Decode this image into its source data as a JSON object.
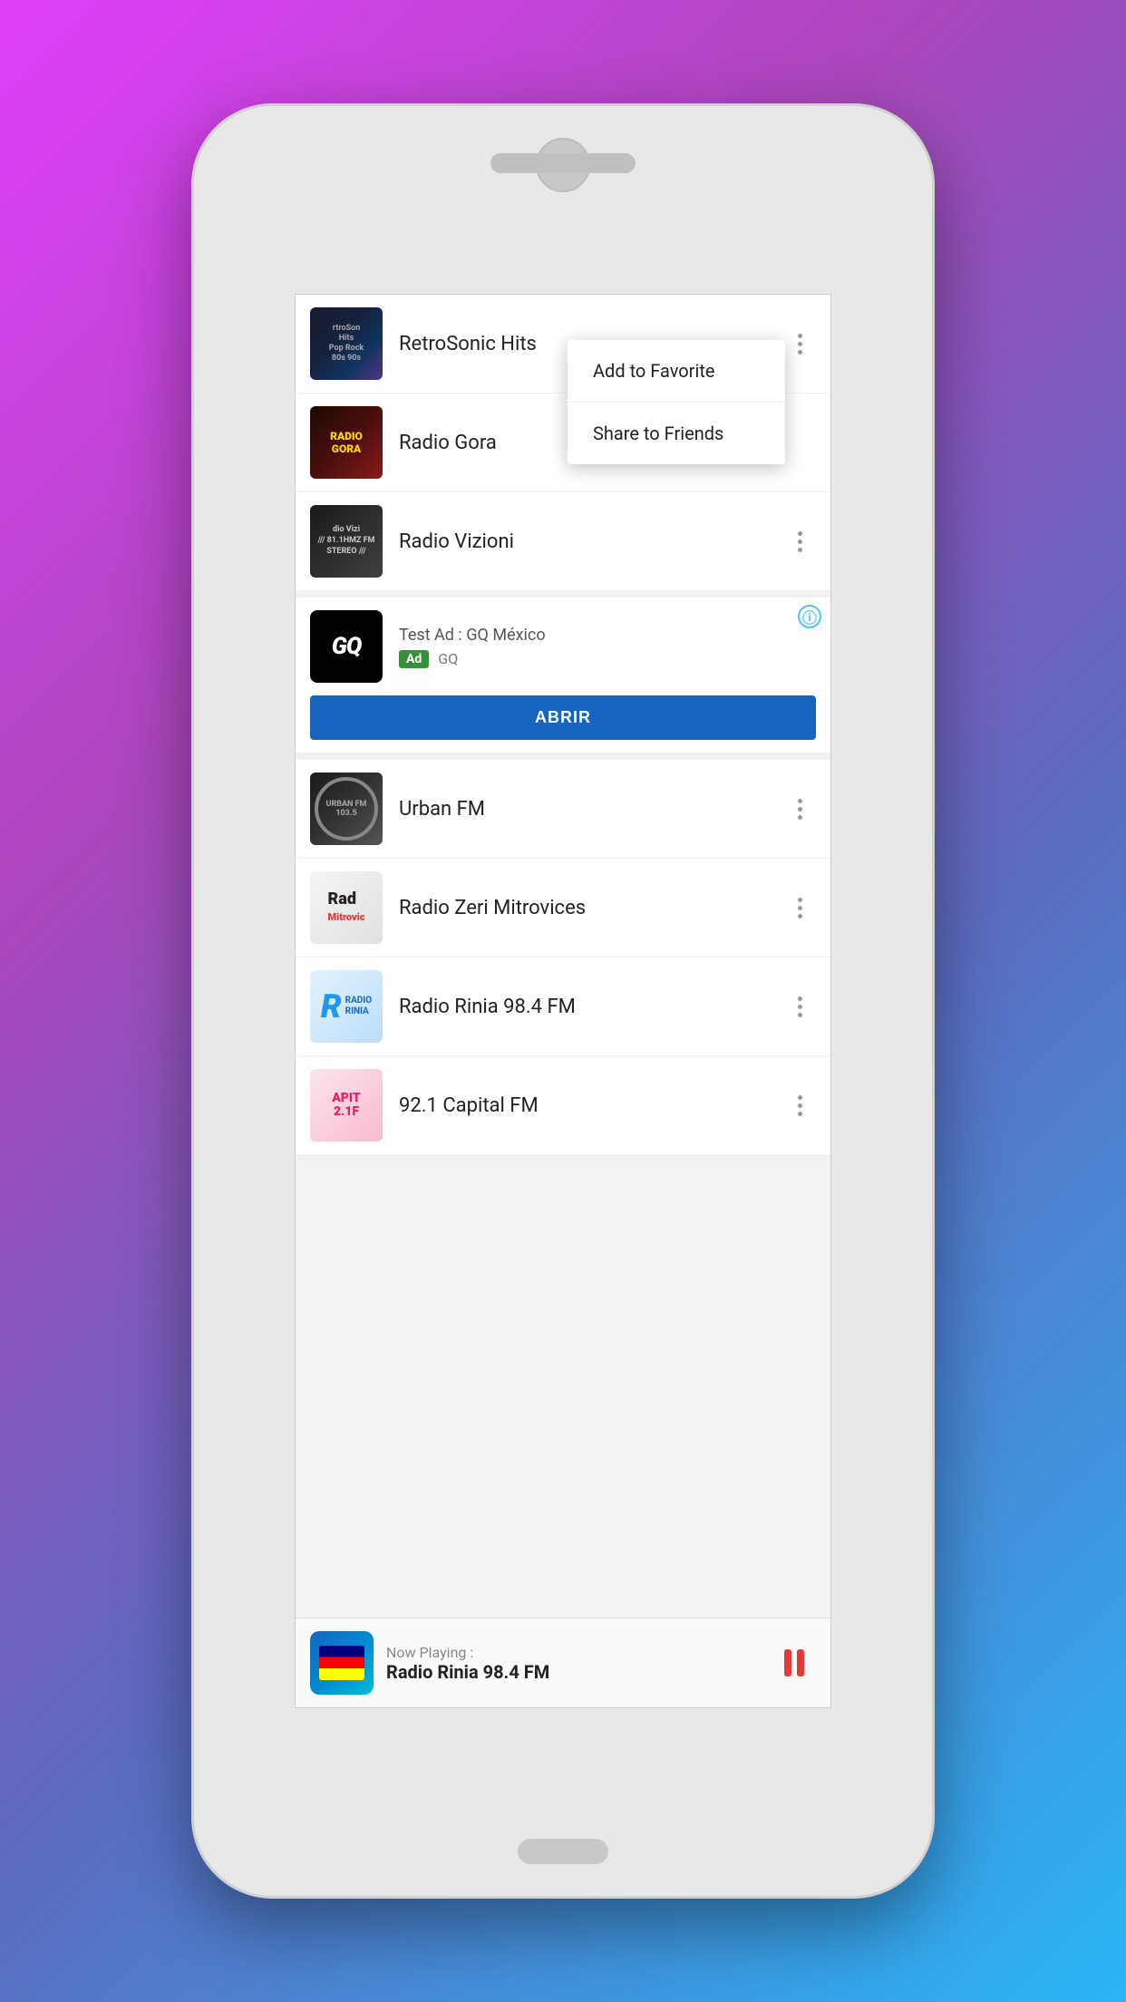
{
  "phone": {
    "background_gradient": "linear-gradient(135deg, #e040fb, #ab47bc, #5c6bc0, #29b6f6)"
  },
  "radio_list": {
    "stations": [
      {
        "id": "retrosonic",
        "name": "RetroSonic Hits",
        "thumb_style": "retrosonic",
        "show_menu": false
      },
      {
        "id": "radiogora",
        "name": "Radio Gora",
        "thumb_style": "radiogora",
        "show_menu": false
      },
      {
        "id": "radiovizioni",
        "name": "Radio Vizioni",
        "thumb_style": "radiovizioni",
        "show_menu": false
      }
    ]
  },
  "context_menu": {
    "visible": true,
    "items": [
      {
        "id": "add-favorite",
        "label": "Add to Favorite"
      },
      {
        "id": "share-friends",
        "label": "Share to Friends"
      }
    ]
  },
  "ad": {
    "title": "Test Ad : GQ México",
    "badge": "Ad",
    "source": "GQ",
    "logo_text": "GQ",
    "open_button_label": "ABRIR"
  },
  "radio_list_2": {
    "stations": [
      {
        "id": "urbanfm",
        "name": "Urban FM",
        "thumb_style": "urbanfm"
      },
      {
        "id": "radrozeri",
        "name": "Radio Zeri Mitrovices",
        "thumb_style": "radrozeri"
      },
      {
        "id": "radiorinia",
        "name": "Radio Rinia 98.4 FM",
        "thumb_style": "radiorinia"
      },
      {
        "id": "capital",
        "name": "92.1 Capital FM",
        "thumb_style": "capital"
      }
    ]
  },
  "now_playing": {
    "label": "Now Playing :",
    "station": "Radio Rinia 98.4 FM"
  }
}
